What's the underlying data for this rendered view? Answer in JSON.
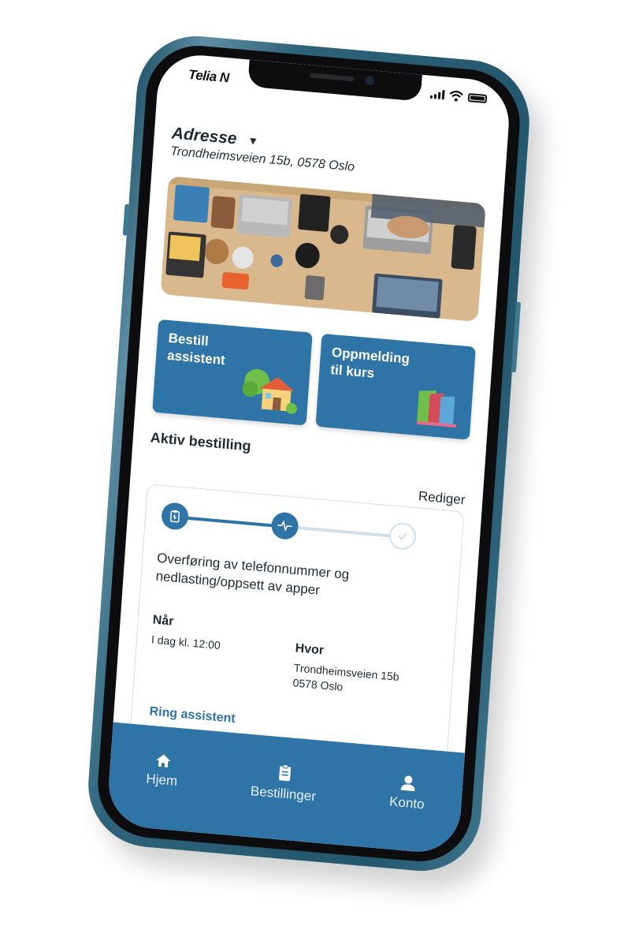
{
  "status_bar": {
    "carrier": "Telia N"
  },
  "address": {
    "title": "Adresse",
    "caret_icon": "caret-down-icon",
    "value": "Trondheimsveien 15b, 0578 Oslo"
  },
  "hero": {
    "image": "workspace-desk-photo"
  },
  "tiles": [
    {
      "label": "Bestill\nassistent",
      "icon": "house-illustration-icon"
    },
    {
      "label": "Oppmelding\ntil kurs",
      "icon": "books-illustration-icon"
    }
  ],
  "active_order": {
    "title": "Aktiv bestilling",
    "edit_label": "Rediger",
    "steps": [
      {
        "icon": "clipboard-icon",
        "state": "done"
      },
      {
        "icon": "activity-icon",
        "state": "done"
      },
      {
        "icon": "check-circle-icon",
        "state": "pending"
      }
    ],
    "description": "Overføring av telefonnummer og nedlasting/oppsett av apper",
    "when_label": "Når",
    "when_value": "I dag kl. 12:00",
    "where_label": "Hvor",
    "where_value": "Trondheimsveien 15b\n0578 Oslo",
    "call_label": "Ring assistent"
  },
  "tabbar": {
    "items": [
      {
        "label": "Hjem",
        "icon": "home-icon"
      },
      {
        "label": "Bestillinger",
        "icon": "clipboard-list-icon"
      },
      {
        "label": "Konto",
        "icon": "user-icon"
      }
    ]
  },
  "colors": {
    "brand": "#2e74a6",
    "text": "#1f2a33",
    "track_pending": "#cfe0ec"
  }
}
